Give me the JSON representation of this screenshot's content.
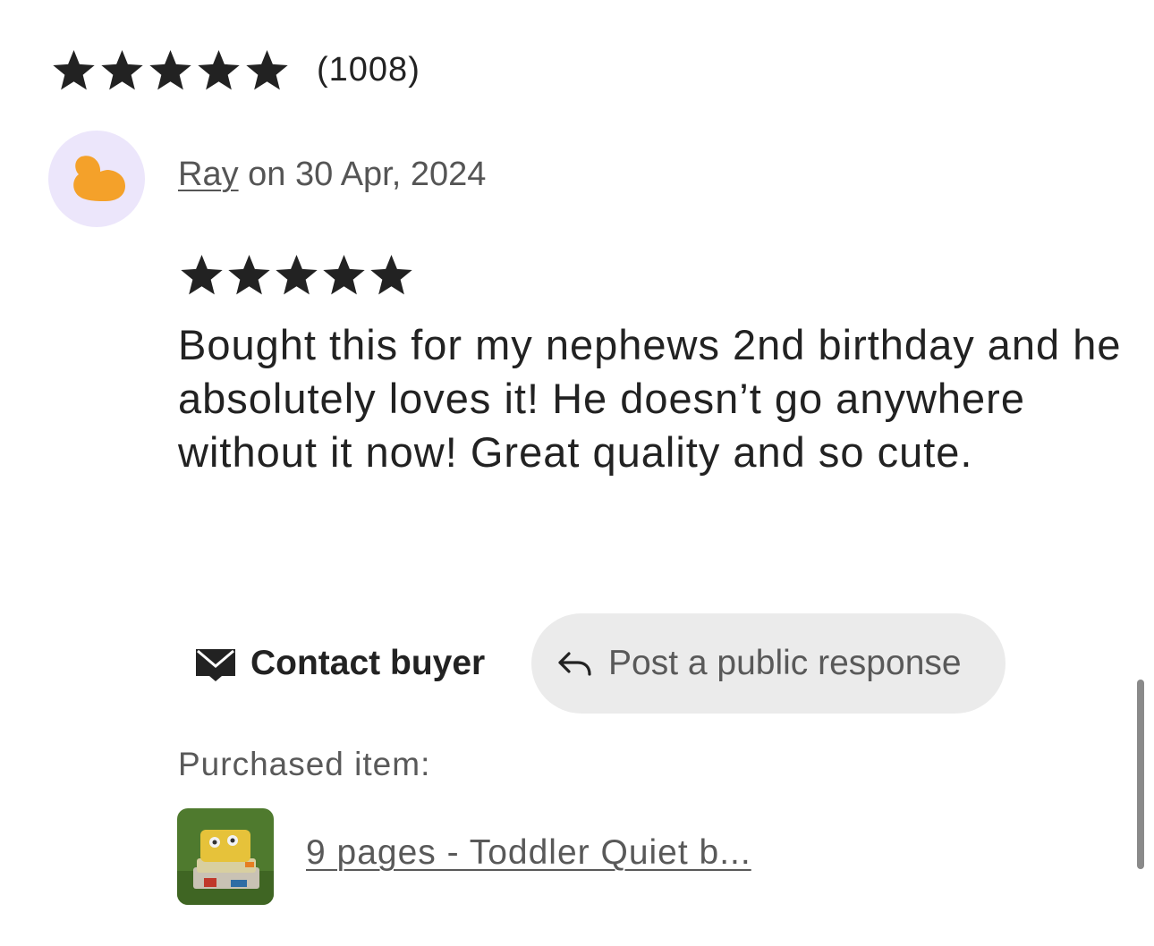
{
  "summary": {
    "rating": 5,
    "max_rating": 5,
    "review_count": "(1008)"
  },
  "review": {
    "reviewer_name": "Ray",
    "date_text": "on 30 Apr, 2024",
    "rating": 5,
    "text": "Bought this for my nephews 2nd birthday and he absolutely loves it! He doesn’t go anywhere without it now! Great quality and so cute."
  },
  "actions": {
    "contact_label": "Contact buyer",
    "response_label": "Post a public response"
  },
  "purchase": {
    "label": "Purchased item:",
    "item_title": "9 pages - Toddler Quiet b..."
  },
  "icons": {
    "star": "star-icon",
    "contact": "envelope-icon",
    "response": "reply-arrow-icon",
    "avatar": "avatar-blob"
  },
  "colors": {
    "text": "#222222",
    "muted": "#595959",
    "avatar_bg": "#ece6fb",
    "avatar_shape": "#f4a12a",
    "button_bg": "#ebebeb"
  }
}
